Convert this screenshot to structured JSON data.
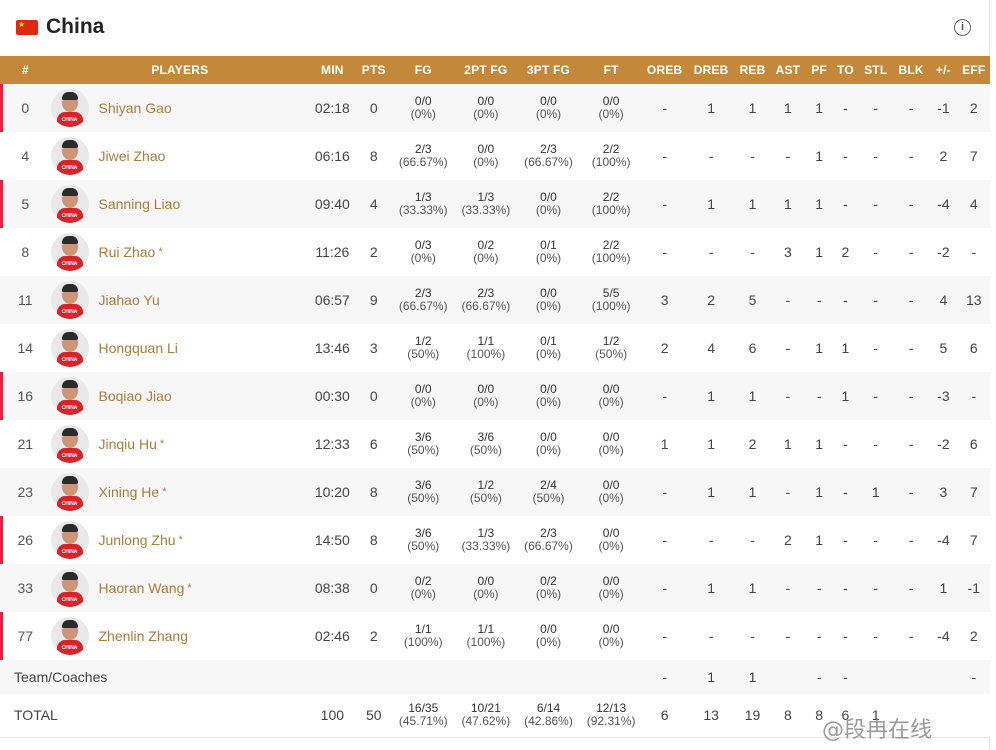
{
  "team": {
    "name": "China",
    "flag_icon": "china-flag-icon",
    "info_icon": "info-icon"
  },
  "columns": [
    "#",
    "PLAYERS",
    "MIN",
    "PTS",
    "FG",
    "2PT FG",
    "3PT FG",
    "FT",
    "OREB",
    "DREB",
    "REB",
    "AST",
    "PF",
    "TO",
    "STL",
    "BLK",
    "+/-",
    "EFF"
  ],
  "players": [
    {
      "num": "0",
      "name": "Shiyan Gao",
      "starred": false,
      "starter": true,
      "min": "02:18",
      "pts": "0",
      "fg": [
        "0/0",
        "(0%)"
      ],
      "fg2": [
        "0/0",
        "(0%)"
      ],
      "fg3": [
        "0/0",
        "(0%)"
      ],
      "ft": [
        "0/0",
        "(0%)"
      ],
      "oreb": "-",
      "dreb": "1",
      "reb": "1",
      "ast": "1",
      "pf": "1",
      "to": "-",
      "stl": "-",
      "blk": "-",
      "pm": "-1",
      "eff": "2"
    },
    {
      "num": "4",
      "name": "Jiwei Zhao",
      "starred": false,
      "starter": false,
      "min": "06:16",
      "pts": "8",
      "fg": [
        "2/3",
        "(66.67%)"
      ],
      "fg2": [
        "0/0",
        "(0%)"
      ],
      "fg3": [
        "2/3",
        "(66.67%)"
      ],
      "ft": [
        "2/2",
        "(100%)"
      ],
      "oreb": "-",
      "dreb": "-",
      "reb": "-",
      "ast": "-",
      "pf": "1",
      "to": "-",
      "stl": "-",
      "blk": "-",
      "pm": "2",
      "eff": "7"
    },
    {
      "num": "5",
      "name": "Sanning Liao",
      "starred": false,
      "starter": true,
      "min": "09:40",
      "pts": "4",
      "fg": [
        "1/3",
        "(33.33%)"
      ],
      "fg2": [
        "1/3",
        "(33.33%)"
      ],
      "fg3": [
        "0/0",
        "(0%)"
      ],
      "ft": [
        "2/2",
        "(100%)"
      ],
      "oreb": "-",
      "dreb": "1",
      "reb": "1",
      "ast": "1",
      "pf": "1",
      "to": "-",
      "stl": "-",
      "blk": "-",
      "pm": "-4",
      "eff": "4"
    },
    {
      "num": "8",
      "name": "Rui Zhao",
      "starred": true,
      "starter": false,
      "min": "11:26",
      "pts": "2",
      "fg": [
        "0/3",
        "(0%)"
      ],
      "fg2": [
        "0/2",
        "(0%)"
      ],
      "fg3": [
        "0/1",
        "(0%)"
      ],
      "ft": [
        "2/2",
        "(100%)"
      ],
      "oreb": "-",
      "dreb": "-",
      "reb": "-",
      "ast": "3",
      "pf": "1",
      "to": "2",
      "stl": "-",
      "blk": "-",
      "pm": "-2",
      "eff": "-"
    },
    {
      "num": "11",
      "name": "Jiahao Yu",
      "starred": false,
      "starter": false,
      "min": "06:57",
      "pts": "9",
      "fg": [
        "2/3",
        "(66.67%)"
      ],
      "fg2": [
        "2/3",
        "(66.67%)"
      ],
      "fg3": [
        "0/0",
        "(0%)"
      ],
      "ft": [
        "5/5",
        "(100%)"
      ],
      "oreb": "3",
      "dreb": "2",
      "reb": "5",
      "ast": "-",
      "pf": "-",
      "to": "-",
      "stl": "-",
      "blk": "-",
      "pm": "4",
      "eff": "13"
    },
    {
      "num": "14",
      "name": "Hongquan Li",
      "starred": false,
      "starter": false,
      "min": "13:46",
      "pts": "3",
      "fg": [
        "1/2",
        "(50%)"
      ],
      "fg2": [
        "1/1",
        "(100%)"
      ],
      "fg3": [
        "0/1",
        "(0%)"
      ],
      "ft": [
        "1/2",
        "(50%)"
      ],
      "oreb": "2",
      "dreb": "4",
      "reb": "6",
      "ast": "-",
      "pf": "1",
      "to": "1",
      "stl": "-",
      "blk": "-",
      "pm": "5",
      "eff": "6"
    },
    {
      "num": "16",
      "name": "Boqiao Jiao",
      "starred": false,
      "starter": true,
      "min": "00:30",
      "pts": "0",
      "fg": [
        "0/0",
        "(0%)"
      ],
      "fg2": [
        "0/0",
        "(0%)"
      ],
      "fg3": [
        "0/0",
        "(0%)"
      ],
      "ft": [
        "0/0",
        "(0%)"
      ],
      "oreb": "-",
      "dreb": "1",
      "reb": "1",
      "ast": "-",
      "pf": "-",
      "to": "1",
      "stl": "-",
      "blk": "-",
      "pm": "-3",
      "eff": "-"
    },
    {
      "num": "21",
      "name": "Jinqiu Hu",
      "starred": true,
      "starter": false,
      "min": "12:33",
      "pts": "6",
      "fg": [
        "3/6",
        "(50%)"
      ],
      "fg2": [
        "3/6",
        "(50%)"
      ],
      "fg3": [
        "0/0",
        "(0%)"
      ],
      "ft": [
        "0/0",
        "(0%)"
      ],
      "oreb": "1",
      "dreb": "1",
      "reb": "2",
      "ast": "1",
      "pf": "1",
      "to": "-",
      "stl": "-",
      "blk": "-",
      "pm": "-2",
      "eff": "6"
    },
    {
      "num": "23",
      "name": "Xining He",
      "starred": true,
      "starter": false,
      "min": "10:20",
      "pts": "8",
      "fg": [
        "3/6",
        "(50%)"
      ],
      "fg2": [
        "1/2",
        "(50%)"
      ],
      "fg3": [
        "2/4",
        "(50%)"
      ],
      "ft": [
        "0/0",
        "(0%)"
      ],
      "oreb": "-",
      "dreb": "1",
      "reb": "1",
      "ast": "-",
      "pf": "1",
      "to": "-",
      "stl": "1",
      "blk": "-",
      "pm": "3",
      "eff": "7"
    },
    {
      "num": "26",
      "name": "Junlong Zhu",
      "starred": true,
      "starter": true,
      "min": "14:50",
      "pts": "8",
      "fg": [
        "3/6",
        "(50%)"
      ],
      "fg2": [
        "1/3",
        "(33.33%)"
      ],
      "fg3": [
        "2/3",
        "(66.67%)"
      ],
      "ft": [
        "0/0",
        "(0%)"
      ],
      "oreb": "-",
      "dreb": "-",
      "reb": "-",
      "ast": "2",
      "pf": "1",
      "to": "-",
      "stl": "-",
      "blk": "-",
      "pm": "-4",
      "eff": "7"
    },
    {
      "num": "33",
      "name": "Haoran Wang",
      "starred": true,
      "starter": false,
      "min": "08:38",
      "pts": "0",
      "fg": [
        "0/2",
        "(0%)"
      ],
      "fg2": [
        "0/0",
        "(0%)"
      ],
      "fg3": [
        "0/2",
        "(0%)"
      ],
      "ft": [
        "0/0",
        "(0%)"
      ],
      "oreb": "-",
      "dreb": "1",
      "reb": "1",
      "ast": "-",
      "pf": "-",
      "to": "-",
      "stl": "-",
      "blk": "-",
      "pm": "1",
      "eff": "-1"
    },
    {
      "num": "77",
      "name": "Zhenlin Zhang",
      "starred": false,
      "starter": true,
      "min": "02:46",
      "pts": "2",
      "fg": [
        "1/1",
        "(100%)"
      ],
      "fg2": [
        "1/1",
        "(100%)"
      ],
      "fg3": [
        "0/0",
        "(0%)"
      ],
      "ft": [
        "0/0",
        "(0%)"
      ],
      "oreb": "-",
      "dreb": "-",
      "reb": "-",
      "ast": "-",
      "pf": "-",
      "to": "-",
      "stl": "-",
      "blk": "-",
      "pm": "-4",
      "eff": "2"
    }
  ],
  "team_row": {
    "label": "Team/Coaches",
    "oreb": "-",
    "dreb": "1",
    "reb": "1",
    "ast": "",
    "pf": "-",
    "to": "-",
    "stl": "",
    "blk": "",
    "pm": "",
    "eff": "-"
  },
  "total_row": {
    "label": "TOTAL",
    "min": "100",
    "pts": "50",
    "fg": [
      "16/35",
      "(45.71%)"
    ],
    "fg2": [
      "10/21",
      "(47.62%)"
    ],
    "fg3": [
      "6/14",
      "(42.86%)"
    ],
    "ft": [
      "12/13",
      "(92.31%)"
    ],
    "oreb": "6",
    "dreb": "13",
    "reb": "19",
    "ast": "8",
    "pf": "8",
    "to": "6",
    "stl": "1",
    "blk": "",
    "pm": "",
    "eff": ""
  },
  "jersey_text": "CHINA",
  "watermark": "@段冉在线",
  "colors": {
    "header_bg": "#c4883a",
    "player_link": "#b07a3a",
    "starter_marker": "#e8213f",
    "flag_red": "#de2910"
  }
}
